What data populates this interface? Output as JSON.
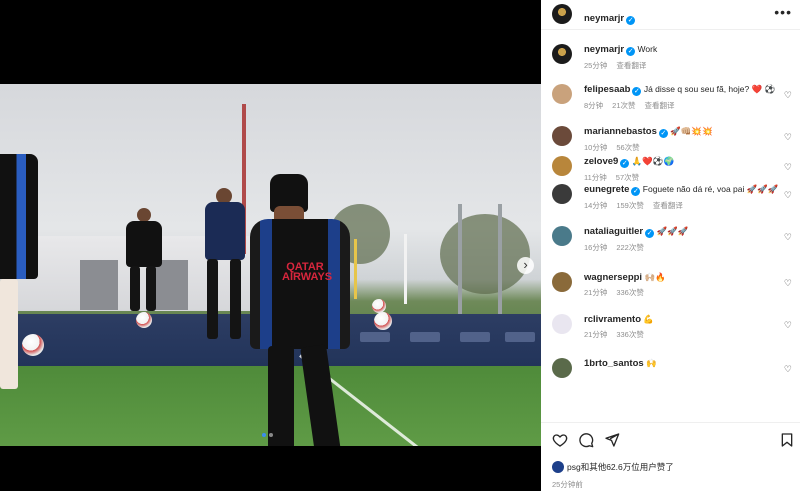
{
  "post": {
    "author": "neymarjr",
    "caption": "Work",
    "caption_time": "25分钟",
    "translate_label": "查看翻译",
    "more_label": "•••"
  },
  "comments": [
    {
      "user": "felipesaab",
      "verified": true,
      "text": "Já disse q sou seu fã, hoje? ❤️ ⚽",
      "time": "8分钟",
      "likes": "21次赞",
      "translate": "查看翻译",
      "avatar_color": "#c9a27c"
    },
    {
      "user": "mariannebastos",
      "verified": true,
      "text": "🚀👊🏼💥💥",
      "time": "10分钟",
      "likes": "56次赞",
      "translate": "",
      "avatar_color": "#6b4a3a"
    },
    {
      "user": "zelove9",
      "verified": true,
      "text": "🙏❤️⚽🌍",
      "time": "11分钟",
      "likes": "57次赞",
      "translate": "",
      "avatar_color": "#b8863b"
    },
    {
      "user": "eunegrete",
      "verified": true,
      "text": "Foguete não dá ré, voa pai 🚀🚀🚀",
      "time": "14分钟",
      "likes": "159次赞",
      "translate": "查看翻译",
      "avatar_color": "#3a3a3a"
    },
    {
      "user": "nataliaguitler",
      "verified": true,
      "text": "🚀🚀🚀",
      "time": "16分钟",
      "likes": "222次赞",
      "translate": "",
      "avatar_color": "#4a7a8a"
    },
    {
      "user": "wagnerseppi",
      "verified": false,
      "text": "🙌🏼🔥",
      "time": "21分钟",
      "likes": "336次赞",
      "translate": "",
      "avatar_color": "#8a6a3a"
    },
    {
      "user": "rclivramento",
      "verified": false,
      "text": "💪",
      "time": "21分钟",
      "likes": "336次赞",
      "translate": "",
      "avatar_color": "#e9e6f0"
    },
    {
      "user": "1brto_santos",
      "verified": false,
      "text": "🙌",
      "time": "",
      "likes": "",
      "translate": "",
      "avatar_color": "#5a6a4a"
    }
  ],
  "footer": {
    "likes_text": "psg和其他62.6万位用户赞了",
    "posted_time": "25分钟前"
  },
  "icons": {
    "carousel_next": "›",
    "heart_small": "♡"
  },
  "media": {
    "slides": 2,
    "current_slide": 1,
    "shirt_text": "QATAR AIRWAYS"
  }
}
